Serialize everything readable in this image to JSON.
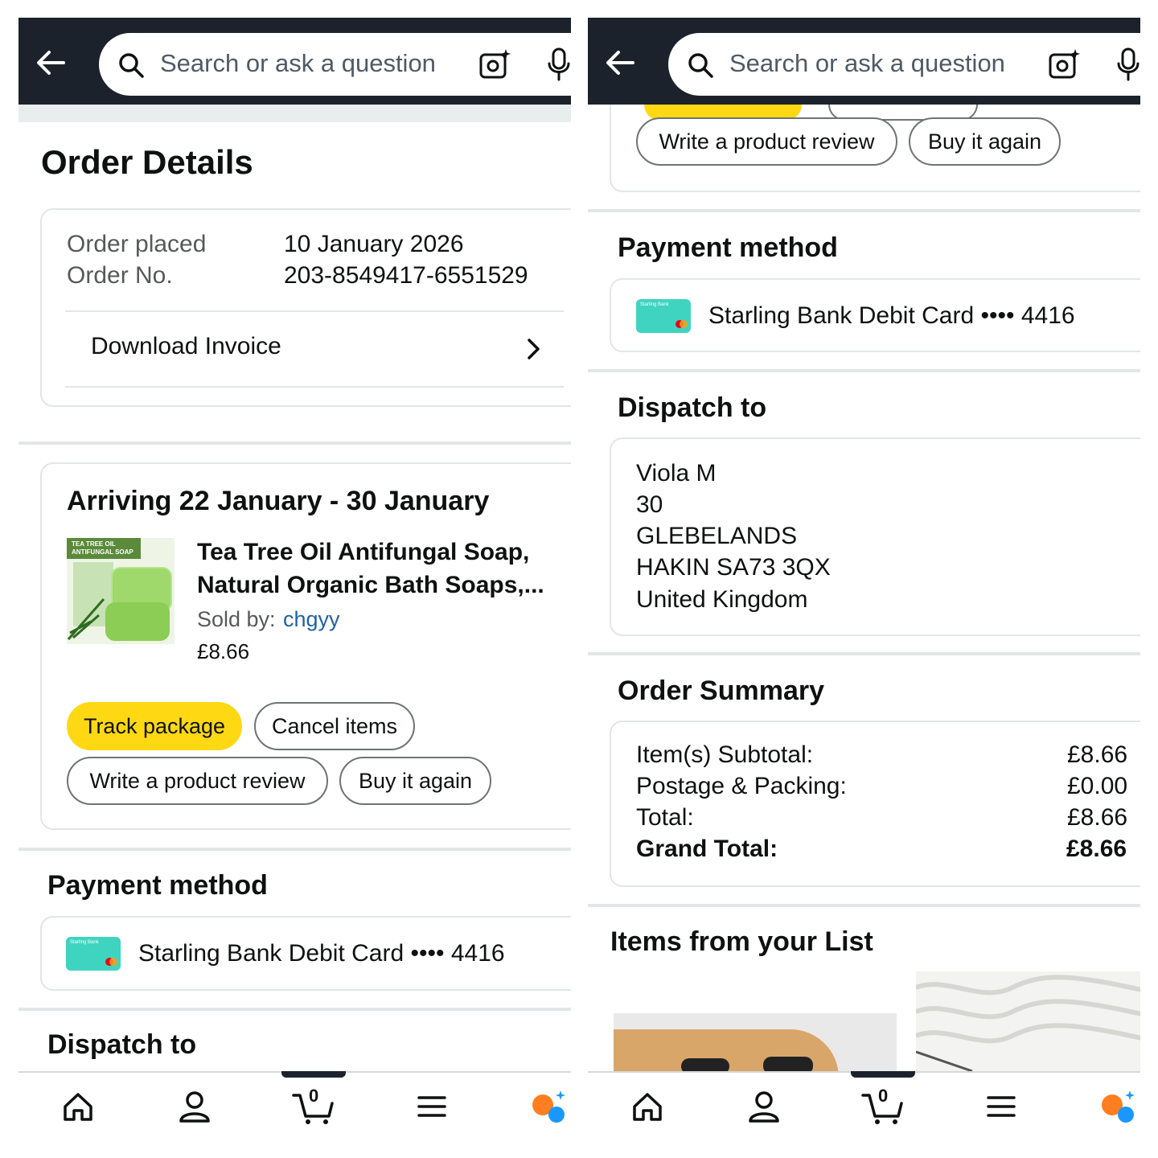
{
  "search": {
    "placeholder": "Search or ask a question"
  },
  "order": {
    "page_title": "Order Details",
    "placed_label": "Order placed",
    "placed_value": "10 January 2026",
    "number_label": "Order No.",
    "number_value": "203-8549417-6551529",
    "download_invoice": "Download Invoice"
  },
  "shipment": {
    "arriving": "Arriving 22 January - 30 January",
    "product_title_line1": "Tea Tree Oil Antifungal Soap,",
    "product_title_line2": "Natural Organic Bath Soaps,...",
    "sold_by_label": "Sold by:",
    "seller": "chgyy",
    "price": "£8.66",
    "image_text": "TEA TREE OIL ANTIFUNGAL SOAP",
    "actions": {
      "track": "Track package",
      "cancel": "Cancel items",
      "review": "Write a product review",
      "buy_again": "Buy it again"
    }
  },
  "payment": {
    "title": "Payment method",
    "card_text": "Starling Bank Debit Card •••• 4416",
    "card_brand": "Starling Bank"
  },
  "dispatch": {
    "title": "Dispatch to",
    "name": "Viola M",
    "line1": "30",
    "line2": "GLEBELANDS",
    "line3": "HAKIN SA73 3QX",
    "country": "United Kingdom"
  },
  "summary": {
    "title": "Order Summary",
    "rows": [
      {
        "label": "Item(s) Subtotal:",
        "value": "£8.66"
      },
      {
        "label": "Postage & Packing:",
        "value": "£0.00"
      },
      {
        "label": "Total:",
        "value": "£8.66"
      }
    ],
    "grand_label": "Grand Total:",
    "grand_value": "£8.66"
  },
  "list": {
    "title": "Items from your List"
  },
  "nav": {
    "cart_count": "0",
    "active": "cart"
  },
  "colors": {
    "header_bg": "#1c222c",
    "primary_button": "#ffd814",
    "link": "#2162a1",
    "card_teal": "#3fd4c0"
  }
}
